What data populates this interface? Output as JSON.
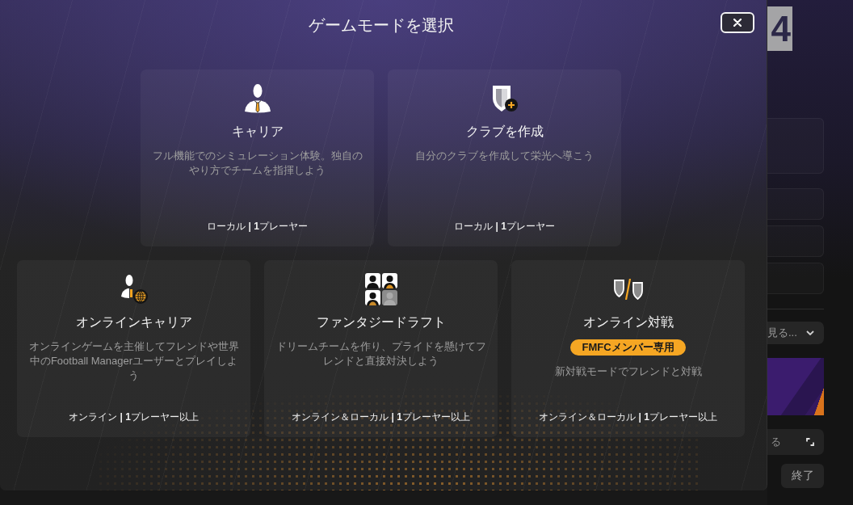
{
  "dialog": {
    "title": "ゲームモードを選択"
  },
  "mode_rows": [
    {
      "modes": [
        {
          "kind": "career",
          "title": "キャリア",
          "description": "フル機能でのシミュレーション体験。独自のやり方でチームを指揮しよう",
          "footer": "ローカル **| 1**プレーヤー"
        },
        {
          "kind": "create-club",
          "title": "クラブを作成",
          "description": "自分のクラブを作成して栄光へ導こう",
          "footer": "ローカル **| 1**プレーヤー"
        }
      ]
    },
    {
      "modes": [
        {
          "kind": "online-career",
          "title": "オンラインキャリア",
          "description": "オンラインゲームを主催してフレンドや世界中のFootball Managerユーザーとプレイしよう",
          "footer": "オンライン **| 1**プレーヤー以上"
        },
        {
          "kind": "fantasy-draft",
          "title": "ファンタジードラフト",
          "description": "ドリームチームを作り、プライドを懸けてフレンドと直接対決しよう",
          "footer": "オンライン＆ローカル **| 1**プレーヤー以上"
        },
        {
          "kind": "online-versus",
          "title": "オンライン対戦",
          "badge": "FMFCメンバー専用",
          "description": "新対戦モードでフレンドと対戦",
          "footer": "オンライン＆ローカル **| 1**プレーヤー以上"
        }
      ]
    }
  ],
  "background_app": {
    "logo": "4",
    "dropdown": "見る...",
    "button": "る",
    "quit_button": "終了"
  }
}
